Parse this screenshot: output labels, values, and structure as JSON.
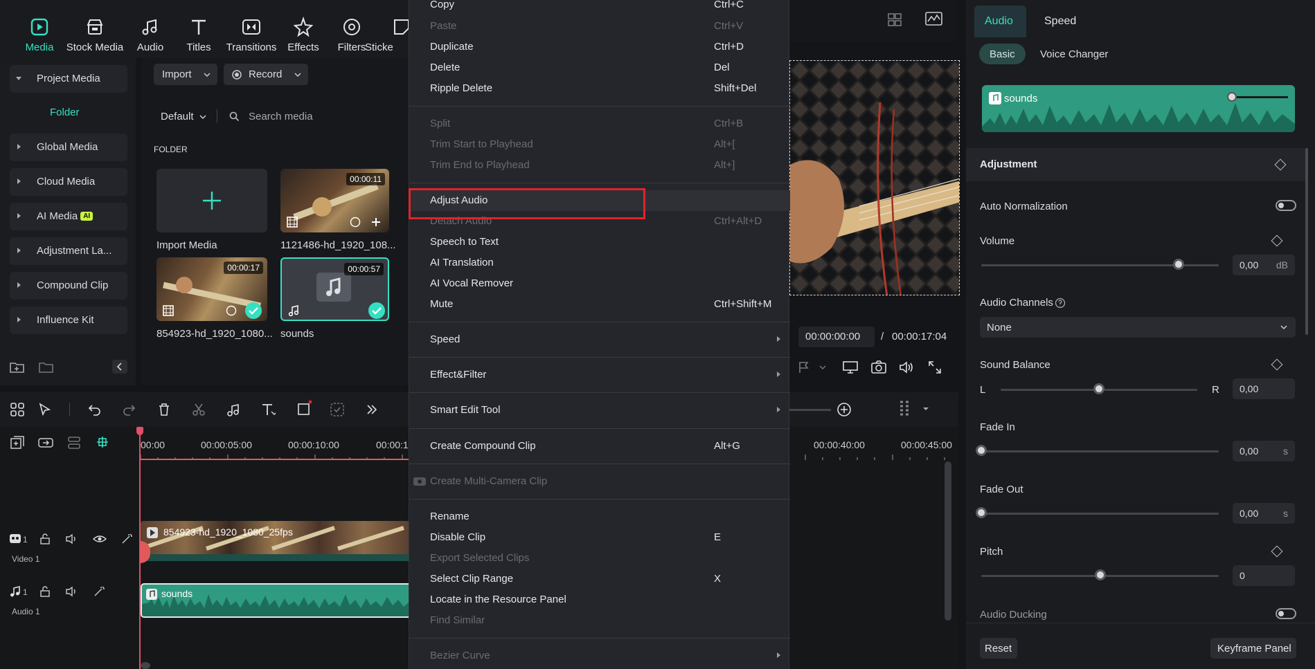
{
  "toolbar": {
    "items": [
      {
        "label": "Media",
        "icon": "media-icon"
      },
      {
        "label": "Stock Media",
        "icon": "stock-media-icon"
      },
      {
        "label": "Audio",
        "icon": "audio-note-icon"
      },
      {
        "label": "Titles",
        "icon": "titles-icon"
      },
      {
        "label": "Transitions",
        "icon": "transitions-icon"
      },
      {
        "label": "Effects",
        "icon": "effects-icon"
      },
      {
        "label": "Filters",
        "icon": "filters-icon"
      },
      {
        "label": "Sticke",
        "icon": "stickers-icon"
      }
    ]
  },
  "sidebar": {
    "items": [
      "Project Media",
      "Global Media",
      "Cloud Media",
      "AI Media",
      "Adjustment La...",
      "Compound Clip",
      "Influence Kit"
    ],
    "folder": "Folder",
    "ai_badge": "AI"
  },
  "media": {
    "import_btn": "Import",
    "record_btn": "Record",
    "sort": "Default",
    "search_placeholder": "Search media",
    "folder_heading": "FOLDER",
    "tiles": [
      {
        "caption": "Import Media"
      },
      {
        "caption": "1121486-hd_1920_108...",
        "duration": "00:00:11"
      },
      {
        "caption": "854923-hd_1920_1080...",
        "duration": "00:00:17"
      },
      {
        "caption": "sounds",
        "duration": "00:00:57"
      }
    ]
  },
  "preview": {
    "current_time": "00:00:00:00",
    "separator": "/",
    "total_time": "00:00:17:04"
  },
  "timeline": {
    "ruler": [
      "00:00",
      "00:00:05:00",
      "00:00:10:00",
      "00:00:1",
      "00:00:40:00",
      "00:00:45:00"
    ],
    "video_track": {
      "num": "1",
      "label": "Video 1",
      "clip": "854923-hd_1920_1080_25fps"
    },
    "audio_track": {
      "num": "1",
      "label": "Audio 1",
      "clip": "sounds"
    }
  },
  "context_menu": {
    "items": [
      {
        "label": "Copy",
        "shortcut": "Ctrl+C",
        "disabled": false
      },
      {
        "label": "Paste",
        "shortcut": "Ctrl+V",
        "disabled": true
      },
      {
        "label": "Duplicate",
        "shortcut": "Ctrl+D",
        "disabled": false
      },
      {
        "label": "Delete",
        "shortcut": "Del",
        "disabled": false
      },
      {
        "label": "Ripple Delete",
        "shortcut": "Shift+Del",
        "disabled": false
      },
      {
        "label": "Split",
        "shortcut": "Ctrl+B",
        "disabled": true
      },
      {
        "label": "Trim Start to Playhead",
        "shortcut": "Alt+[",
        "disabled": true
      },
      {
        "label": "Trim End to Playhead",
        "shortcut": "Alt+]",
        "disabled": true
      },
      {
        "label": "Adjust Audio",
        "shortcut": "",
        "disabled": false
      },
      {
        "label": "Detach Audio",
        "shortcut": "Ctrl+Alt+D",
        "disabled": true
      },
      {
        "label": "Speech to Text",
        "shortcut": "",
        "disabled": false
      },
      {
        "label": "AI Translation",
        "shortcut": "",
        "disabled": false
      },
      {
        "label": "AI Vocal Remover",
        "shortcut": "",
        "disabled": false
      },
      {
        "label": "Mute",
        "shortcut": "Ctrl+Shift+M",
        "disabled": false
      },
      {
        "label": "Speed",
        "shortcut": "",
        "disabled": false
      },
      {
        "label": "Effect&Filter",
        "shortcut": "",
        "disabled": false
      },
      {
        "label": "Smart Edit Tool",
        "shortcut": "",
        "disabled": false
      },
      {
        "label": "Create Compound Clip",
        "shortcut": "Alt+G",
        "disabled": false
      },
      {
        "label": "Create Multi-Camera Clip",
        "shortcut": "",
        "disabled": true
      },
      {
        "label": "Rename",
        "shortcut": "",
        "disabled": false
      },
      {
        "label": "Disable Clip",
        "shortcut": "E",
        "disabled": false
      },
      {
        "label": "Export Selected Clips",
        "shortcut": "",
        "disabled": true
      },
      {
        "label": "Select Clip Range",
        "shortcut": "X",
        "disabled": false
      },
      {
        "label": "Locate in the Resource Panel",
        "shortcut": "",
        "disabled": false
      },
      {
        "label": "Find Similar",
        "shortcut": "",
        "disabled": true
      },
      {
        "label": "Bezier Curve",
        "shortcut": "",
        "disabled": true
      }
    ]
  },
  "panel": {
    "tabs": [
      "Audio",
      "Speed"
    ],
    "subtabs": [
      "Basic",
      "Voice Changer"
    ],
    "clip_name": "sounds",
    "adjustment": "Adjustment",
    "auto_normalization": "Auto Normalization",
    "volume": {
      "label": "Volume",
      "value": "0,00",
      "unit": "dB",
      "level": 0.83
    },
    "audio_channels": {
      "label": "Audio Channels",
      "selected": "None"
    },
    "sound_balance": {
      "label": "Sound Balance",
      "left": "L",
      "right": "R",
      "value": "0,00",
      "level": 0.5
    },
    "fade_in": {
      "label": "Fade In",
      "value": "0,00",
      "unit": "s",
      "level": 0
    },
    "fade_out": {
      "label": "Fade Out",
      "value": "0,00",
      "unit": "s",
      "level": 0
    },
    "pitch": {
      "label": "Pitch",
      "value": "0",
      "level": 0.5
    },
    "audio_ducking": "Audio Ducking",
    "reset_btn": "Reset",
    "keyframe_btn": "Keyframe Panel"
  },
  "colors": {
    "accent": "#35e0c2",
    "highlight": "#e0242b",
    "waveform": "#2f9b80"
  }
}
